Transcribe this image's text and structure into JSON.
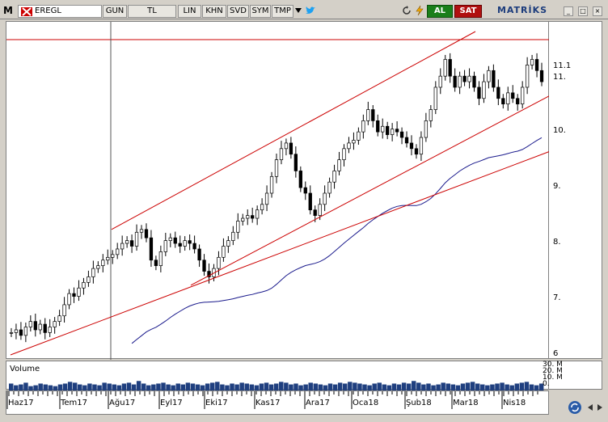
{
  "toolbar": {
    "menu_label": "M",
    "symbol": "EREGL",
    "period": "GUN",
    "currency": "TL",
    "scale": "LIN",
    "khn": "KHN",
    "svd": "SVD",
    "sym": "SYM",
    "tmp": "TMP",
    "buy_label": "AL",
    "sell_label": "SAT",
    "brand": "MATRİKS",
    "minimize": "_",
    "maximize": "□",
    "close": "×"
  },
  "icons": {
    "symbol_flag": "x-icon",
    "dropdown": "triangle-down-icon",
    "twitter": "twitter-icon",
    "refresh1": "refresh-icon",
    "lightning": "lightning-icon",
    "refresh_bottom": "refresh-icon"
  },
  "colors": {
    "candles": "#000000",
    "trend_lines": "#cc0000",
    "moving_average": "#1a1a8c",
    "volume": "#1f3f7f",
    "buy": "#1a7f1a",
    "sell": "#b01010"
  },
  "chart_data": {
    "type": "candlestick",
    "symbol": "EREGL",
    "y_ticks": [
      "11.1",
      "11.",
      "10.",
      "9.",
      "8.",
      "7.",
      "6"
    ],
    "ylim": [
      6,
      11.8
    ],
    "x_ticks": [
      "Haz17",
      "Tem17",
      "Ağu17",
      "Eyl17",
      "Eki17",
      "Kas17",
      "Ara17",
      "Oca18",
      "Şub18",
      "Mar18",
      "Nis18"
    ],
    "close_series": [
      6.4,
      6.45,
      6.35,
      6.5,
      6.6,
      6.45,
      6.55,
      6.4,
      6.5,
      6.6,
      6.7,
      6.9,
      7.1,
      7.05,
      7.2,
      7.3,
      7.4,
      7.55,
      7.6,
      7.7,
      7.75,
      7.8,
      7.9,
      8.0,
      8.05,
      7.95,
      8.2,
      8.25,
      8.1,
      7.7,
      7.6,
      7.85,
      8.05,
      8.1,
      8.0,
      7.95,
      8.05,
      8.0,
      7.9,
      7.7,
      7.5,
      7.4,
      7.55,
      7.75,
      7.95,
      8.05,
      8.2,
      8.4,
      8.45,
      8.5,
      8.45,
      8.6,
      8.7,
      8.9,
      9.2,
      9.5,
      9.7,
      9.8,
      9.6,
      9.3,
      9.0,
      8.9,
      8.6,
      8.5,
      8.7,
      8.9,
      9.1,
      9.3,
      9.5,
      9.7,
      9.8,
      9.85,
      10.0,
      10.2,
      10.4,
      10.2,
      10.0,
      10.1,
      9.95,
      10.05,
      10.0,
      9.9,
      9.8,
      9.7,
      9.6,
      9.9,
      10.2,
      10.4,
      10.8,
      11.0,
      11.3,
      11.0,
      10.8,
      11.0,
      10.9,
      11.0,
      10.8,
      10.6,
      10.9,
      11.1,
      10.8,
      10.6,
      10.5,
      10.7,
      10.6,
      10.5,
      10.8,
      11.2,
      11.3,
      11.1,
      10.9
    ],
    "volume_label": "Volume",
    "volume_ticks": [
      "30. M",
      "20. M",
      "10. M",
      "0."
    ],
    "volume_values": [
      8,
      6,
      7,
      9,
      5,
      6,
      8,
      7,
      6,
      5,
      7,
      8,
      10,
      9,
      7,
      6,
      8,
      7,
      6,
      9,
      8,
      7,
      6,
      8,
      9,
      7,
      11,
      8,
      6,
      7,
      8,
      9,
      7,
      6,
      8,
      7,
      9,
      8,
      7,
      6,
      8,
      9,
      10,
      7,
      6,
      8,
      7,
      9,
      8,
      7,
      6,
      8,
      9,
      7,
      8,
      10,
      9,
      7,
      8,
      6,
      7,
      9,
      8,
      7,
      6,
      8,
      7,
      9,
      8,
      10,
      9,
      8,
      7,
      6,
      8,
      9,
      7,
      6,
      8,
      7,
      9,
      8,
      11,
      9,
      7,
      8,
      6,
      7,
      9,
      8,
      7,
      6,
      8,
      9,
      10,
      8,
      7,
      6,
      7,
      8,
      9,
      7,
      6,
      8,
      9,
      10,
      7,
      6,
      8
    ]
  }
}
